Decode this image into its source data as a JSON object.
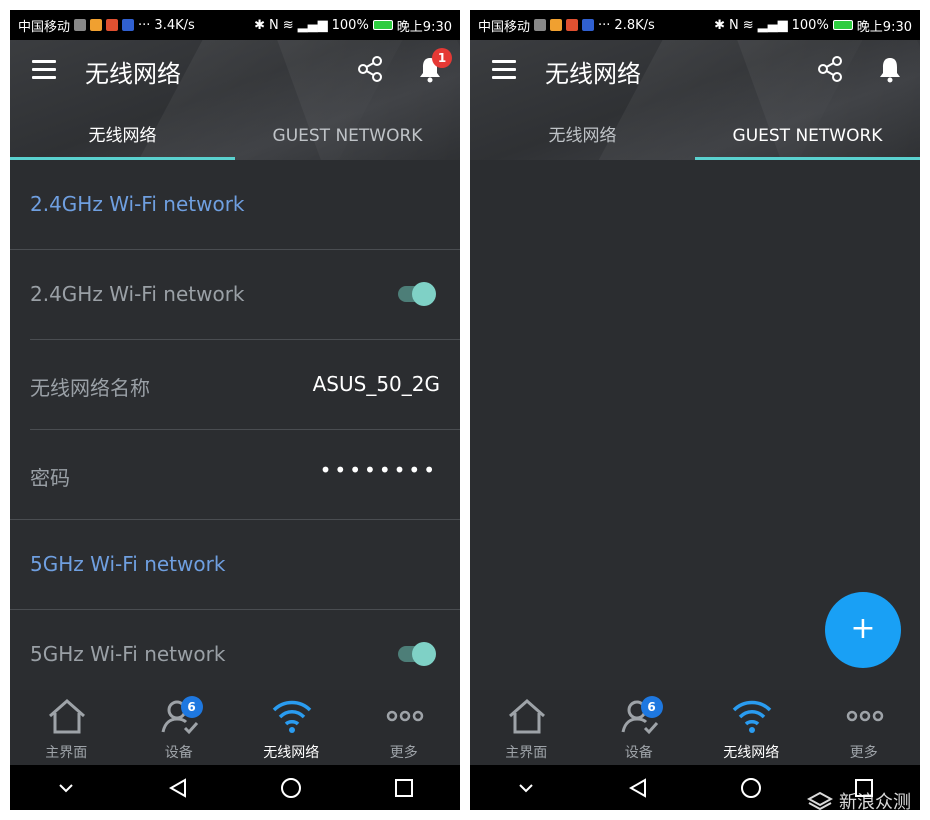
{
  "left_screen": {
    "status": {
      "carrier": "中国移动",
      "speed": "3.4K/s",
      "battery": "100%",
      "time": "晚上9:30",
      "ellipsis": "···"
    },
    "app_title": "无线网络",
    "notification_count": "1",
    "tabs": [
      {
        "label": "无线网络",
        "active": true
      },
      {
        "label": "GUEST NETWORK",
        "active": false
      }
    ],
    "rows": [
      {
        "type": "header",
        "label": "2.4GHz Wi-Fi network"
      },
      {
        "type": "toggle",
        "label": "2.4GHz Wi-Fi network",
        "on": true
      },
      {
        "type": "value",
        "label": "无线网络名称",
        "value": "ASUS_50_2G"
      },
      {
        "type": "password",
        "label": "密码",
        "value": "••••••••"
      },
      {
        "type": "header",
        "label": "5GHz Wi-Fi network"
      },
      {
        "type": "toggle",
        "label": "5GHz Wi-Fi network",
        "on": true
      }
    ]
  },
  "right_screen": {
    "status": {
      "carrier": "中国移动",
      "speed": "2.8K/s",
      "battery": "100%",
      "time": "晚上9:30",
      "ellipsis": "···"
    },
    "app_title": "无线网络",
    "tabs": [
      {
        "label": "无线网络",
        "active": false
      },
      {
        "label": "GUEST NETWORK",
        "active": true
      }
    ],
    "fab_label": "+"
  },
  "bottom_nav": [
    {
      "label": "主界面",
      "icon": "home-icon"
    },
    {
      "label": "设备",
      "icon": "devices-icon",
      "badge": "6"
    },
    {
      "label": "无线网络",
      "icon": "wifi-icon",
      "active": true
    },
    {
      "label": "更多",
      "icon": "more-icon"
    }
  ],
  "watermark": "新浪众测",
  "colors": {
    "accent_tab": "#5ad1cf",
    "header_text": "#6f9fe0",
    "fab": "#19a0f5",
    "badge_blue": "#1e78e0",
    "badge_red": "#e53935"
  }
}
